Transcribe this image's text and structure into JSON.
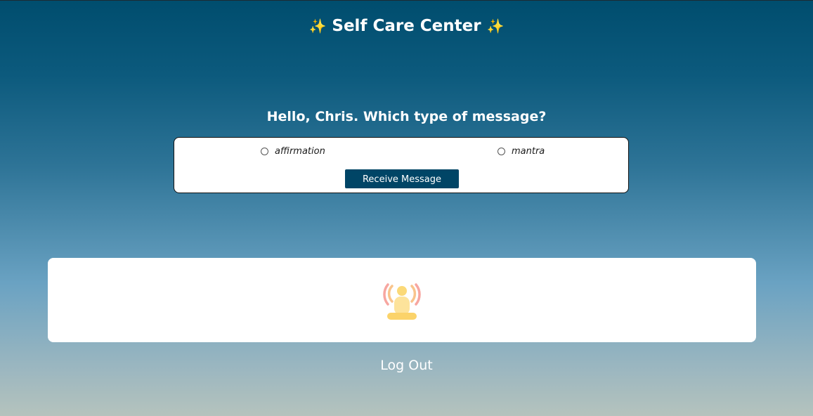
{
  "header": {
    "title": "Self Care Center",
    "sparkle_left": "✨",
    "sparkle_right": "✨"
  },
  "prompt": {
    "greeting": "Hello, Chris. Which type of message?"
  },
  "options": [
    {
      "label": "affirmation",
      "selected": false
    },
    {
      "label": "mantra",
      "selected": false
    }
  ],
  "actions": {
    "receive_label": "Receive Message",
    "logout_label": "Log Out"
  },
  "message_area": {
    "icon": "meditation-icon"
  },
  "colors": {
    "button_bg": "#004566",
    "gradient_top": "#004d6e",
    "gradient_bottom": "#b5c3bd"
  }
}
